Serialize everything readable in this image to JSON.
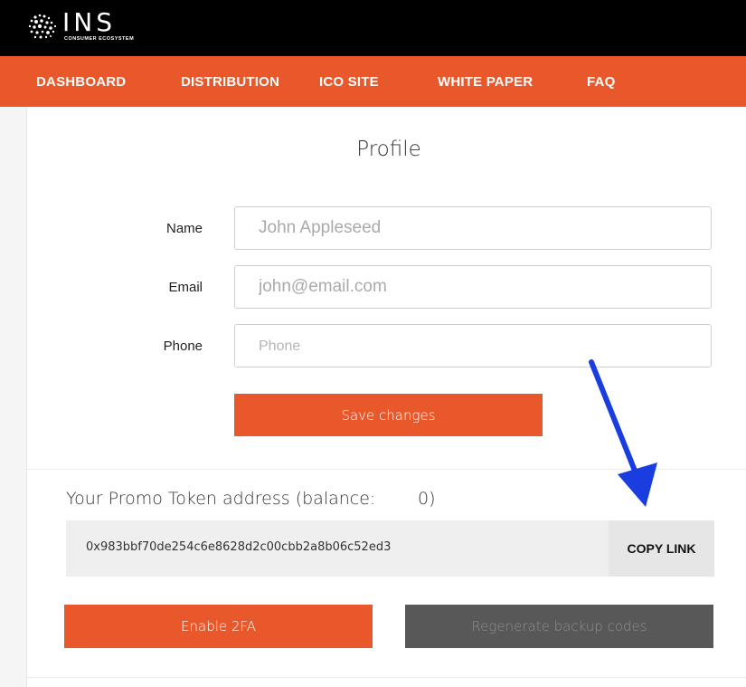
{
  "brand": {
    "name": "INS",
    "tagline": "CONSUMER ECOSYSTEM"
  },
  "nav": {
    "items": [
      {
        "label": "DASHBOARD"
      },
      {
        "label": "DISTRIBUTION"
      },
      {
        "label": "ICO SITE"
      },
      {
        "label": "WHITE PAPER"
      },
      {
        "label": "FAQ"
      }
    ]
  },
  "profile": {
    "title": "Profile",
    "fields": [
      {
        "label": "Name",
        "placeholder": "John Appleseed"
      },
      {
        "label": "Email",
        "placeholder": "john@email.com"
      },
      {
        "label": "Phone",
        "placeholder": "Phone"
      }
    ],
    "save_label": "Save changes"
  },
  "promo": {
    "label": "Your Promo Token address (balance:",
    "balance": "0)",
    "address": "0x983bbf70de254c6e8628d2c00cbb2a8b06c52ed3",
    "copy_label": "COPY LINK"
  },
  "security": {
    "enable_2fa_label": "Enable 2FA",
    "regenerate_label": "Regenerate backup codes"
  },
  "colors": {
    "accent": "#e8582b",
    "topbar": "#000000",
    "annotation_arrow": "#1a3de0",
    "disabled_button": "#585858"
  }
}
